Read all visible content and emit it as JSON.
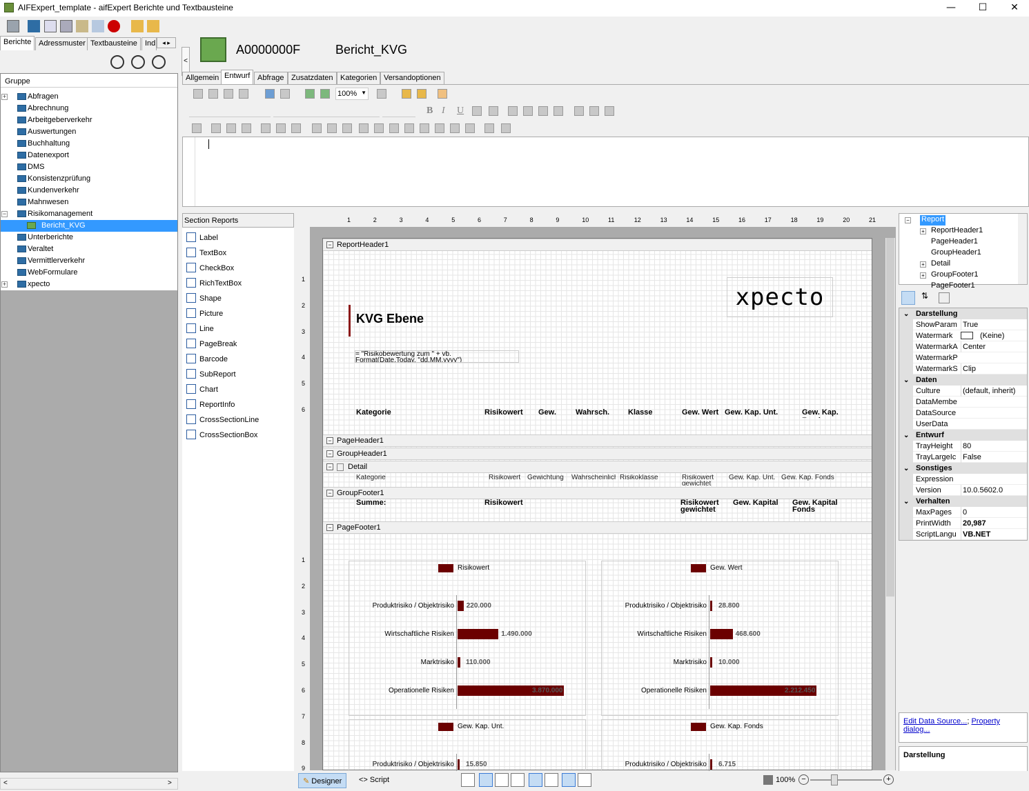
{
  "window": {
    "title": "AIFExpert_template - aifExpert Berichte und Textbausteine",
    "minimize": "—",
    "maximize": "☐",
    "close": "✕"
  },
  "left_tabs": [
    "Berichte",
    "Adressmuster",
    "Textbausteine",
    "Ind"
  ],
  "tree": {
    "header": "Gruppe",
    "items": [
      {
        "label": "Abfragen",
        "expandable": true
      },
      {
        "label": "Abrechnung",
        "expandable": false
      },
      {
        "label": "Arbeitgeberverkehr",
        "expandable": false
      },
      {
        "label": "Auswertungen",
        "expandable": false
      },
      {
        "label": "Buchhaltung",
        "expandable": false
      },
      {
        "label": "Datenexport",
        "expandable": false
      },
      {
        "label": "DMS",
        "expandable": false
      },
      {
        "label": "Konsistenzprüfung",
        "expandable": false
      },
      {
        "label": "Kundenverkehr",
        "expandable": false
      },
      {
        "label": "Mahnwesen",
        "expandable": false
      },
      {
        "label": "Risikomanagement",
        "expandable": true,
        "expanded": true
      },
      {
        "label": "Bericht_KVG",
        "child": true,
        "selected": true
      },
      {
        "label": "Unterberichte",
        "expandable": false
      },
      {
        "label": "Veraltet",
        "expandable": false
      },
      {
        "label": "Vermittlerverkehr",
        "expandable": false
      },
      {
        "label": "WebFormulare",
        "expandable": false
      },
      {
        "label": "xpecto",
        "expandable": true
      }
    ]
  },
  "report": {
    "id": "A0000000F",
    "name": "Bericht_KVG"
  },
  "right_tabs": [
    "Allgemein",
    "Entwurf",
    "Abfrage",
    "Zusatzdaten",
    "Kategorien",
    "Versandoptionen"
  ],
  "active_right_tab": "Entwurf",
  "zoom_select": "100%",
  "toolbox": {
    "header": "Section Reports",
    "items": [
      "Label",
      "TextBox",
      "CheckBox",
      "RichTextBox",
      "Shape",
      "Picture",
      "Line",
      "PageBreak",
      "Barcode",
      "SubReport",
      "Chart",
      "ReportInfo",
      "CrossSectionLine",
      "CrossSectionBox"
    ]
  },
  "ruler_top": [
    "1",
    "2",
    "3",
    "4",
    "5",
    "6",
    "7",
    "8",
    "9",
    "10",
    "11",
    "12",
    "13",
    "14",
    "15",
    "16",
    "17",
    "18",
    "19",
    "20",
    "21"
  ],
  "ruler_left_a": [
    "1",
    "2",
    "3",
    "4",
    "5",
    "6"
  ],
  "ruler_left_b": [
    "1",
    "2",
    "3",
    "4",
    "5",
    "6",
    "7",
    "8",
    "9"
  ],
  "design": {
    "bands": {
      "report_header": "ReportHeader1",
      "page_header": "PageHeader1",
      "group_header": "GroupHeader1",
      "detail": "Detail",
      "group_footer": "GroupFooter1",
      "page_footer": "PageFooter1"
    },
    "logo_text": "xpecto",
    "heading": "KVG Ebene",
    "expression_line1": "= \"Risikobewertung zum \" + vb.",
    "expression_line2": "Format(Date.Today, \"dd.MM.yyyy\")",
    "header_cols": [
      "Kategorie",
      "Risikowert",
      "Gew.",
      "Wahrsch.",
      "Klasse",
      "Gew. Wert",
      "Gew. Kap. Unt.",
      "Gew. Kap. Fonds"
    ],
    "detail_cols": [
      "Kategorie",
      "Risikowert",
      "Gewichtung",
      "Wahrscheinlichkeit",
      "Risikoklasse",
      "Risikowert gewichtet",
      "Gew. Kap. Unt.",
      "Gew. Kap. Fonds"
    ],
    "footer_cols": [
      "Summe:",
      "Risikowert",
      "Risikowert gewichtet",
      "Gew. Kapital",
      "Gew. Kapital Fonds"
    ]
  },
  "chart_data": [
    {
      "type": "bar",
      "orientation": "horizontal",
      "title": "",
      "series": [
        {
          "name": "Risikowert",
          "values": [
            220000,
            1490000,
            110000,
            3870000
          ]
        }
      ],
      "categories": [
        "Produktrisiko / Objektrisiko",
        "Wirtschaftliche Risiken",
        "Marktrisiko",
        "Operationelle Risiken"
      ],
      "value_labels": [
        "220.000",
        "1.490.000",
        "110.000",
        "3.870.000"
      ],
      "xlim": [
        0,
        3870000
      ],
      "legend": "top",
      "color": "#6b0000"
    },
    {
      "type": "bar",
      "orientation": "horizontal",
      "title": "",
      "series": [
        {
          "name": "Gew. Wert",
          "values": [
            28800,
            468600,
            10000,
            2212450
          ]
        }
      ],
      "categories": [
        "Produktrisiko / Objektrisiko",
        "Wirtschaftliche Risiken",
        "Marktrisiko",
        "Operationelle Risiken"
      ],
      "value_labels": [
        "28.800",
        "468.600",
        "10.000",
        "2.212.450"
      ],
      "xlim": [
        0,
        2212450
      ],
      "legend": "top",
      "color": "#6b0000"
    },
    {
      "type": "bar",
      "orientation": "horizontal",
      "title": "",
      "series": [
        {
          "name": "Gew. Kap. Unt.",
          "values": [
            15850
          ]
        }
      ],
      "categories": [
        "Produktrisiko / Objektrisiko"
      ],
      "value_labels": [
        "15.850"
      ],
      "legend": "top",
      "color": "#6b0000"
    },
    {
      "type": "bar",
      "orientation": "horizontal",
      "title": "",
      "series": [
        {
          "name": "Gew. Kap. Fonds",
          "values": [
            6715
          ]
        }
      ],
      "categories": [
        "Produktrisiko / Objektrisiko"
      ],
      "value_labels": [
        "6.715"
      ],
      "legend": "top",
      "color": "#6b0000"
    }
  ],
  "property_tree": [
    "Report",
    "ReportHeader1",
    "PageHeader1",
    "GroupHeader1",
    "Detail",
    "GroupFooter1",
    "PageFooter1"
  ],
  "properties": [
    {
      "cat": "Darstellung",
      "rows": [
        [
          "ShowParam",
          "True"
        ],
        [
          "Watermark",
          "(Keine)"
        ],
        [
          "WatermarkA",
          "Center"
        ],
        [
          "WatermarkP",
          ""
        ],
        [
          "WatermarkS",
          "Clip"
        ]
      ]
    },
    {
      "cat": "Daten",
      "rows": [
        [
          "Culture",
          "(default, inherit)"
        ],
        [
          "DataMembe",
          ""
        ],
        [
          "DataSource",
          ""
        ],
        [
          "UserData",
          ""
        ]
      ]
    },
    {
      "cat": "Entwurf",
      "rows": [
        [
          "TrayHeight",
          "80"
        ],
        [
          "TrayLargeIc",
          "False"
        ]
      ]
    },
    {
      "cat": "Sonstiges",
      "rows": [
        [
          "Expression",
          ""
        ],
        [
          "Version",
          "10.0.5602.0"
        ]
      ]
    },
    {
      "cat": "Verhalten",
      "rows": [
        [
          "MaxPages",
          "0"
        ],
        [
          "PrintWidth",
          "20,987"
        ],
        [
          "ScriptLangu",
          "VB.NET"
        ]
      ]
    }
  ],
  "prop_links": {
    "edit": "Edit Data Source...",
    "sep": ";",
    "dialog1": "Property",
    "dialog2": "dialog..."
  },
  "prop_description": "Darstellung",
  "bottom": {
    "designer": "Designer",
    "script": "Script",
    "zoom": "100%"
  },
  "colors": {
    "selection": "#3399ff",
    "bar": "#6b0000",
    "accent_red": "#8b1a1a"
  }
}
